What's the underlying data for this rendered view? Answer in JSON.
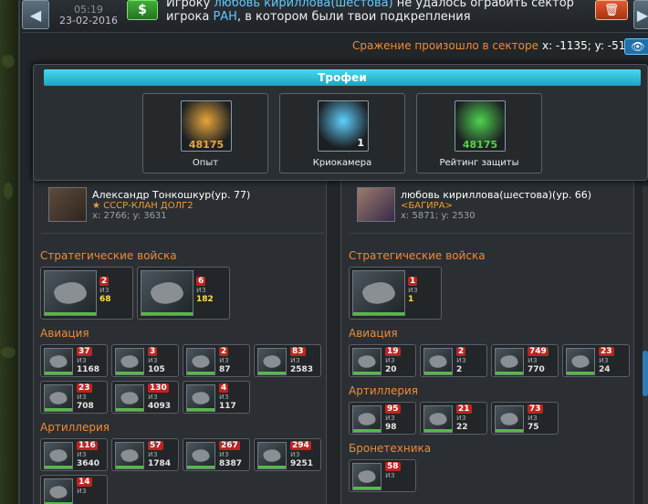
{
  "header": {
    "date_top": "05:19",
    "date": "23-02-2016",
    "money_icon": "$",
    "message_pre": "Игроку ",
    "message_name": "любовь кириллова(шестова)",
    "message_mid": " не удалось ограбить сектор игрока ",
    "message_name2": "РAH",
    "message_post": ", в котором были твои подкрепления",
    "battle_text": "Сражение произошло в секторе",
    "battle_coords": "x: -1135; y: -5135"
  },
  "trophies": {
    "title": "Трофеи",
    "items": [
      {
        "label": "Опыт",
        "value": "48175",
        "icon": "rank-icon",
        "color": "#e8a53a"
      },
      {
        "label": "Криокамера",
        "value": "1",
        "icon": "cryo-chamber-icon",
        "color": "#5fd0ff"
      },
      {
        "label": "Рейтинг защиты",
        "value": "48175",
        "icon": "shield-rating-icon",
        "color": "#4fd34f"
      }
    ]
  },
  "left": {
    "name": "Александр Тонкошкур(ур. 77)",
    "clan": "★ СССР-КЛАН ДОЛГ2",
    "coords": "x: 2766; y: 3631",
    "sections": [
      {
        "title": "Стратегические войска",
        "units": [
          {
            "a": "2",
            "b": "68",
            "y": true
          },
          {
            "a": "6",
            "b": "182",
            "y": true
          }
        ]
      },
      {
        "title": "Авиация",
        "units": [
          {
            "a": "37",
            "b": "1168"
          },
          {
            "a": "3",
            "b": "105"
          },
          {
            "a": "2",
            "b": "87"
          },
          {
            "a": "83",
            "b": "2583"
          },
          {
            "a": "23",
            "b": "708"
          },
          {
            "a": "130",
            "b": "4093"
          },
          {
            "a": "4",
            "b": "117"
          }
        ]
      },
      {
        "title": "Артиллерия",
        "units": [
          {
            "a": "116",
            "b": "3640"
          },
          {
            "a": "57",
            "b": "1784"
          },
          {
            "a": "267",
            "b": "8387"
          },
          {
            "a": "294",
            "b": "9251"
          },
          {
            "a": "14",
            "b": ""
          }
        ]
      }
    ]
  },
  "right": {
    "name": "любовь кириллова(шестова)(ур. 66)",
    "clan": "<БАГИРА>",
    "coords": "x: 5871; y: 2530",
    "sections": [
      {
        "title": "Стратегические войска",
        "units": [
          {
            "a": "1",
            "b": "1",
            "y": true
          }
        ]
      },
      {
        "title": "Авиация",
        "units": [
          {
            "a": "19",
            "b": "20"
          },
          {
            "a": "2",
            "b": "2"
          },
          {
            "a": "749",
            "b": "770"
          },
          {
            "a": "23",
            "b": "24"
          }
        ]
      },
      {
        "title": "Артиллерия",
        "units": [
          {
            "a": "95",
            "b": "98"
          },
          {
            "a": "21",
            "b": "22"
          },
          {
            "a": "73",
            "b": "75"
          }
        ]
      },
      {
        "title": "Бронетехника",
        "units": [
          {
            "a": "58",
            "b": ""
          }
        ]
      }
    ]
  },
  "labels": {
    "of": "из"
  }
}
